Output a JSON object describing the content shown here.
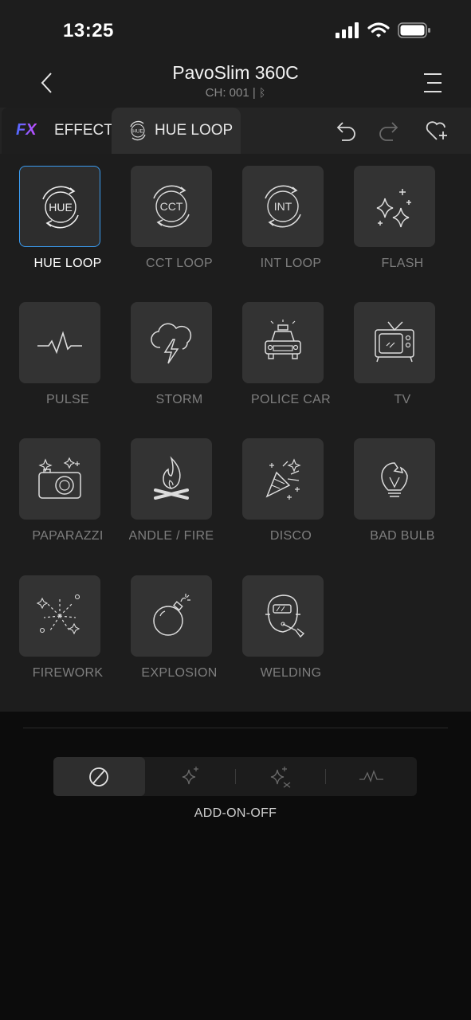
{
  "status_bar": {
    "time": "13:25",
    "icons": [
      "signal-icon",
      "wifi-icon",
      "battery-icon"
    ]
  },
  "header": {
    "title": "PavoSlim 360C",
    "subtitle": "CH: 001  |"
  },
  "tabs": [
    {
      "logo": "FX",
      "label": "EFFECT"
    },
    {
      "icon": "HUE",
      "label": "HUE LOOP"
    }
  ],
  "effects": [
    {
      "label": "HUE LOOP",
      "icon_text": "HUE",
      "selected": true
    },
    {
      "label": "CCT LOOP",
      "icon_text": "CCT"
    },
    {
      "label": "INT LOOP",
      "icon_text": "INT"
    },
    {
      "label": "FLASH"
    },
    {
      "label": "PULSE"
    },
    {
      "label": "STORM"
    },
    {
      "label": "POLICE CAR"
    },
    {
      "label": "TV"
    },
    {
      "label": "PAPARAZZI"
    },
    {
      "label": "CANDLE / FIRE"
    },
    {
      "label": "DISCO"
    },
    {
      "label": "BAD BULB"
    },
    {
      "label": "FIREWORK"
    },
    {
      "label": "EXPLOSION"
    },
    {
      "label": "WELDING"
    }
  ],
  "addon": {
    "label": "ADD-ON-OFF",
    "options": [
      "off-icon",
      "sparkle-icon",
      "sparkle-shuffle-icon",
      "pulse-wave-icon"
    ],
    "selected_index": 0
  },
  "colors": {
    "accent": "#3a9bf0",
    "tile": "#333333",
    "panel": "#1d1d1d"
  }
}
